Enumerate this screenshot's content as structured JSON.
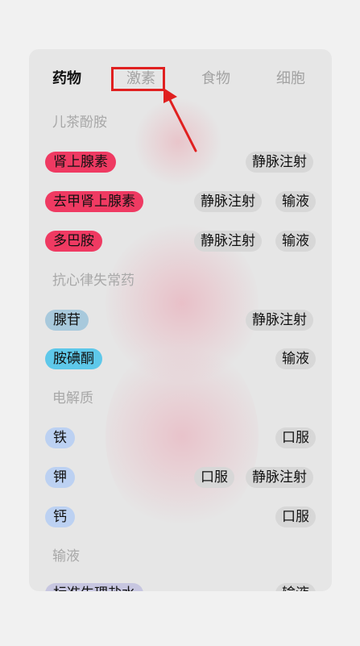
{
  "tabs": [
    "药物",
    "激素",
    "食物",
    "细胞"
  ],
  "sections": [
    {
      "title": "儿茶酚胺",
      "items": [
        {
          "name": "肾上腺素",
          "color": "#ef3a62",
          "tags": [
            "静脉注射"
          ]
        },
        {
          "name": "去甲肾上腺素",
          "color": "#ef3a62",
          "tags": [
            "静脉注射",
            "输液"
          ]
        },
        {
          "name": "多巴胺",
          "color": "#ef3a62",
          "tags": [
            "静脉注射",
            "输液"
          ]
        }
      ]
    },
    {
      "title": "抗心律失常药",
      "items": [
        {
          "name": "腺苷",
          "color": "#a8c9dc",
          "tags": [
            "静脉注射"
          ]
        },
        {
          "name": "胺碘酮",
          "color": "#5ec8ea",
          "tags": [
            "输液"
          ]
        }
      ]
    },
    {
      "title": "电解质",
      "items": [
        {
          "name": "铁",
          "color": "#bcd1f2",
          "tags": [
            "口服"
          ]
        },
        {
          "name": "钾",
          "color": "#bcd1f2",
          "tags": [
            "口服",
            "静脉注射"
          ]
        },
        {
          "name": "钙",
          "color": "#bcd1f2",
          "tags": [
            "口服"
          ]
        }
      ]
    },
    {
      "title": "输液",
      "items": [
        {
          "name": "标准生理盐水",
          "color": "#c7c6e0",
          "tags": [
            "输液"
          ]
        }
      ]
    }
  ],
  "annotation": {
    "highlight_color": "#e02020"
  }
}
